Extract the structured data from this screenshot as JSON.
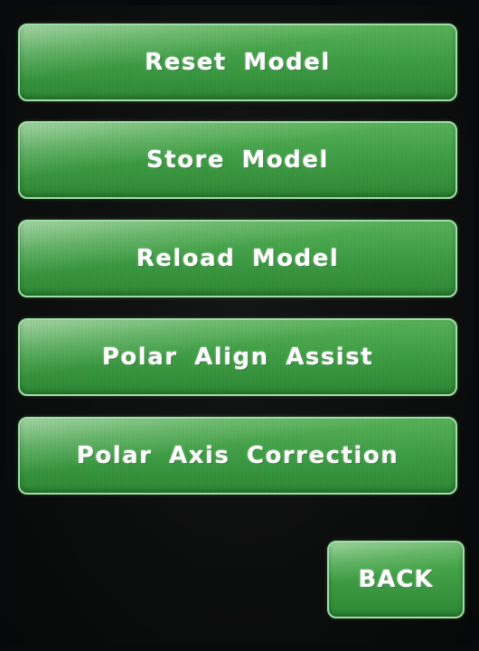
{
  "menu": {
    "items": [
      {
        "label": "Reset Model"
      },
      {
        "label": "Store Model"
      },
      {
        "label": "Reload Model"
      },
      {
        "label": "Polar Align Assist"
      },
      {
        "label": "Polar Axis Correction"
      }
    ]
  },
  "footer": {
    "back_label": "BACK"
  },
  "colors": {
    "background": "#0d0f0e",
    "button_green": "#45a34a",
    "button_border": "#9fe0a6",
    "text": "#ffffff"
  }
}
